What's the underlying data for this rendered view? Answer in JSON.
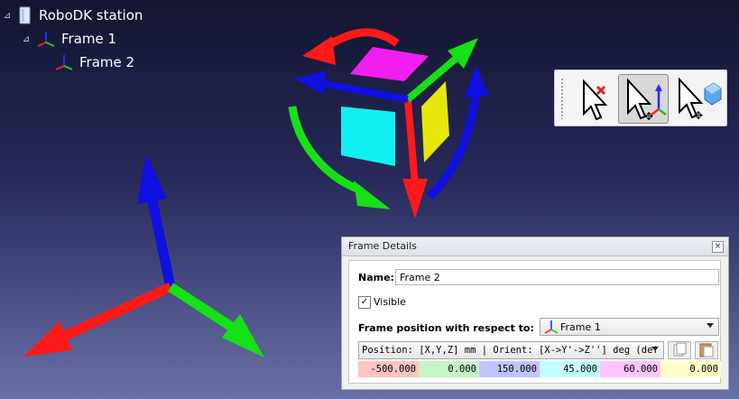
{
  "tree": {
    "station": {
      "label": "RoboDK station",
      "icon": "station-icon"
    },
    "frame1": {
      "label": "Frame 1",
      "icon": "reference-frame-icon"
    },
    "frame2": {
      "label": "Frame 2",
      "icon": "reference-frame-icon"
    }
  },
  "toolbar": {
    "buttons": [
      {
        "name": "select-none-cursor",
        "icon": "cursor-delete-icon",
        "active": false
      },
      {
        "name": "move-reference-cursor",
        "icon": "cursor-move-frame-icon",
        "active": true
      },
      {
        "name": "move-object-cursor",
        "icon": "cursor-move-object-icon",
        "active": false
      }
    ]
  },
  "panel": {
    "title": "Frame Details",
    "close": "×",
    "name_label": "Name:",
    "name_value": "Frame 2",
    "visible_label": "Visible",
    "visible_checked": "✓",
    "position_label": "Frame position with respect to:",
    "reference": "Frame 1",
    "format": "Position: [X,Y,Z] mm | Orient: [X->Y'->Z''] deg (def",
    "values": [
      "-500.000",
      "0.000",
      "150.000",
      "45.000",
      "60.000",
      "0.000"
    ]
  },
  "colors": {
    "x_axis": "#ff1a1a",
    "y_axis": "#16e016",
    "z_axis": "#1010e0",
    "cube_magenta": "#f01ff0",
    "cube_cyan": "#10f0f0",
    "cube_yellow": "#e6e60a",
    "cell_x": "#ffc4c4",
    "cell_y": "#c4f5c4",
    "cell_z": "#c0c4ff",
    "cell_rx": "#c4ffff",
    "cell_ry": "#ffc4ff",
    "cell_rz": "#ffffc8"
  }
}
